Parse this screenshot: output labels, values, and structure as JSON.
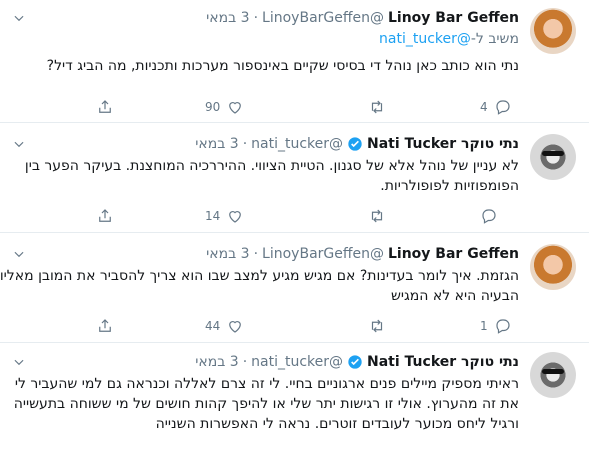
{
  "tweets": [
    {
      "name": "Linoy Bar Geffen",
      "handle": "@LinoyBarGeffen",
      "dot": "·",
      "date": "3 במאי",
      "reply_prefix": "משיב ל-",
      "reply_link": "@nati_tucker",
      "text": "נתי הוא כותב כאן נוהל די בסיסי שקיים באינספור מערכות ותכניות, מה הביג דיל?",
      "reply_count": "4",
      "retweet_count": "",
      "like_count": "90",
      "verified": false
    },
    {
      "name": "נתי טוקר Nati Tucker",
      "handle": "@nati_tucker",
      "dot": "·",
      "date": "3 במאי",
      "text": "לא עניין של נוהל אלא של סגנון. הטיית הציווי. ההיררכיה המוחצנת. בעיקר הפער בין הפומפוזיות לפופולריות.",
      "reply_count": "",
      "retweet_count": "",
      "like_count": "14",
      "verified": true
    },
    {
      "name": "Linoy Bar Geffen",
      "handle": "@LinoyBarGeffen",
      "dot": "·",
      "date": "3 במאי",
      "text": "הגזמת. איך לומר בעדינות? אם מגיש מגיע למצב שבו הוא צריך להסביר את המובן מאליו הבעיה היא לא המגיש",
      "reply_count": "1",
      "retweet_count": "",
      "like_count": "44",
      "verified": false
    },
    {
      "name": "נתי טוקר Nati Tucker",
      "handle": "@nati_tucker",
      "dot": "·",
      "date": "3 במאי",
      "text": "ראיתי מספיק מיילים פנים ארגוניים בחיי. לי זה צרם לאללה וכנראה גם למי שהעביר לי את זה מהערוץ. אולי זו רגישות יתר שלי או להיפך קהות חושים של מי ששוחה בתעשייה ורגיל ליחס מכוער לעובדים זוטרים. נראה לי האפשרות השנייה",
      "verified": true
    }
  ]
}
